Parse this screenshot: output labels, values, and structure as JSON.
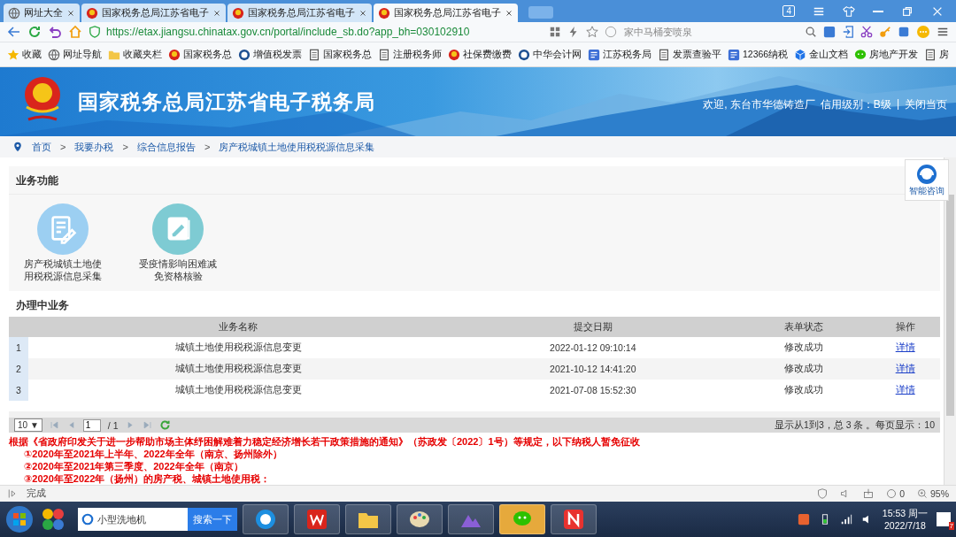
{
  "browser": {
    "tabs": [
      {
        "label": "网址大全",
        "selected": false,
        "kind": "globe"
      },
      {
        "label": "国家税务总局江苏省电子",
        "selected": false,
        "kind": "emblem"
      },
      {
        "label": "国家税务总局江苏省电子",
        "selected": false,
        "kind": "emblem"
      },
      {
        "label": "国家税务总局江苏省电子",
        "selected": true,
        "kind": "emblem"
      }
    ],
    "tab_count": "4",
    "url": "https://etax.jiangsu.chinatax.gov.cn/portal/include_sb.do?app_bh=030102910",
    "search": {
      "placeholder": "家中马桶变喷泉"
    },
    "bookmarks": [
      {
        "label": "收藏",
        "kind": "star"
      },
      {
        "label": "网址导航",
        "kind": "globe"
      },
      {
        "label": "收藏夹栏",
        "kind": "folder"
      },
      {
        "label": "国家税务总",
        "kind": "emblem"
      },
      {
        "label": "增值税发票",
        "kind": "seal"
      },
      {
        "label": "国家税务总",
        "kind": "page"
      },
      {
        "label": "注册税务师",
        "kind": "page"
      },
      {
        "label": "社保费缴费",
        "kind": "emblem"
      },
      {
        "label": "中华会计网",
        "kind": "seal"
      },
      {
        "label": "江苏税务局",
        "kind": "tile"
      },
      {
        "label": "发票查验平",
        "kind": "page"
      },
      {
        "label": "12366纳税",
        "kind": "tile"
      },
      {
        "label": "金山文档",
        "kind": "cube"
      },
      {
        "label": "房地产开发",
        "kind": "chat"
      },
      {
        "label": "房",
        "kind": "page"
      }
    ]
  },
  "header": {
    "title": "国家税务总局江苏省电子税务局",
    "welcome": "欢迎, 东台市华德铸造厂",
    "credit": "信用级别：B级",
    "separator": "|",
    "close": "关闭当页"
  },
  "breadcrumb": {
    "separator": ">",
    "items": [
      "首页",
      "我要办税",
      "综合信息报告",
      "房产税城镇土地使用税税源信息采集"
    ]
  },
  "assistant": {
    "label": "智能咨询"
  },
  "functions": {
    "title": "业务功能",
    "items": [
      {
        "label": "房产税城镇土地使用税税源信息采集",
        "color": "#9ccff2",
        "kind": "form"
      },
      {
        "label": "受疫情影响困难减免资格核验",
        "color": "#7ecbd3",
        "kind": "edit"
      }
    ]
  },
  "in_progress": {
    "title": "办理中业务",
    "table": {
      "columns": [
        "业务名称",
        "提交日期",
        "表单状态",
        "操作"
      ],
      "rows": [
        {
          "index": "1",
          "name": "城镇土地使用税税源信息变更",
          "date": "2022-01-12 09:10:14",
          "status": "修改成功",
          "action": "详情"
        },
        {
          "index": "2",
          "name": "城镇土地使用税税源信息变更",
          "date": "2021-10-12 14:41:20",
          "status": "修改成功",
          "action": "详情"
        },
        {
          "index": "3",
          "name": "城镇土地使用税税源信息变更",
          "date": "2021-07-08 15:52:30",
          "status": "修改成功",
          "action": "详情"
        }
      ]
    },
    "pager": {
      "page_size": "10",
      "page_size_caret": "▼",
      "page": "1",
      "total_pages": "/ 1",
      "summary": "显示从1到3，总 3 条 。每页显示：10"
    }
  },
  "notice": {
    "intro": "根据《省政府印发关于进一步帮助市场主体纾困解难着力稳定经济增长若干政策措施的通知》（苏政发〔2022〕1号）等规定，以下纳税人暂免征收",
    "items": [
      "①2020年至2021年上半年、2022年全年（南京、扬州除外）",
      "②2020年至2021年第三季度、2022年全年（南京）",
      "③2020年至2022年（扬州）的房产税、城镇土地使用税："
    ]
  },
  "status_bar": {
    "text": "完成",
    "count": "0",
    "zoom": "95%"
  },
  "taskbar": {
    "search": {
      "value": "小型洗地机",
      "button": "搜索一下"
    },
    "time": "15:53 周一",
    "date": "2022/7/18",
    "notifications": "7"
  }
}
